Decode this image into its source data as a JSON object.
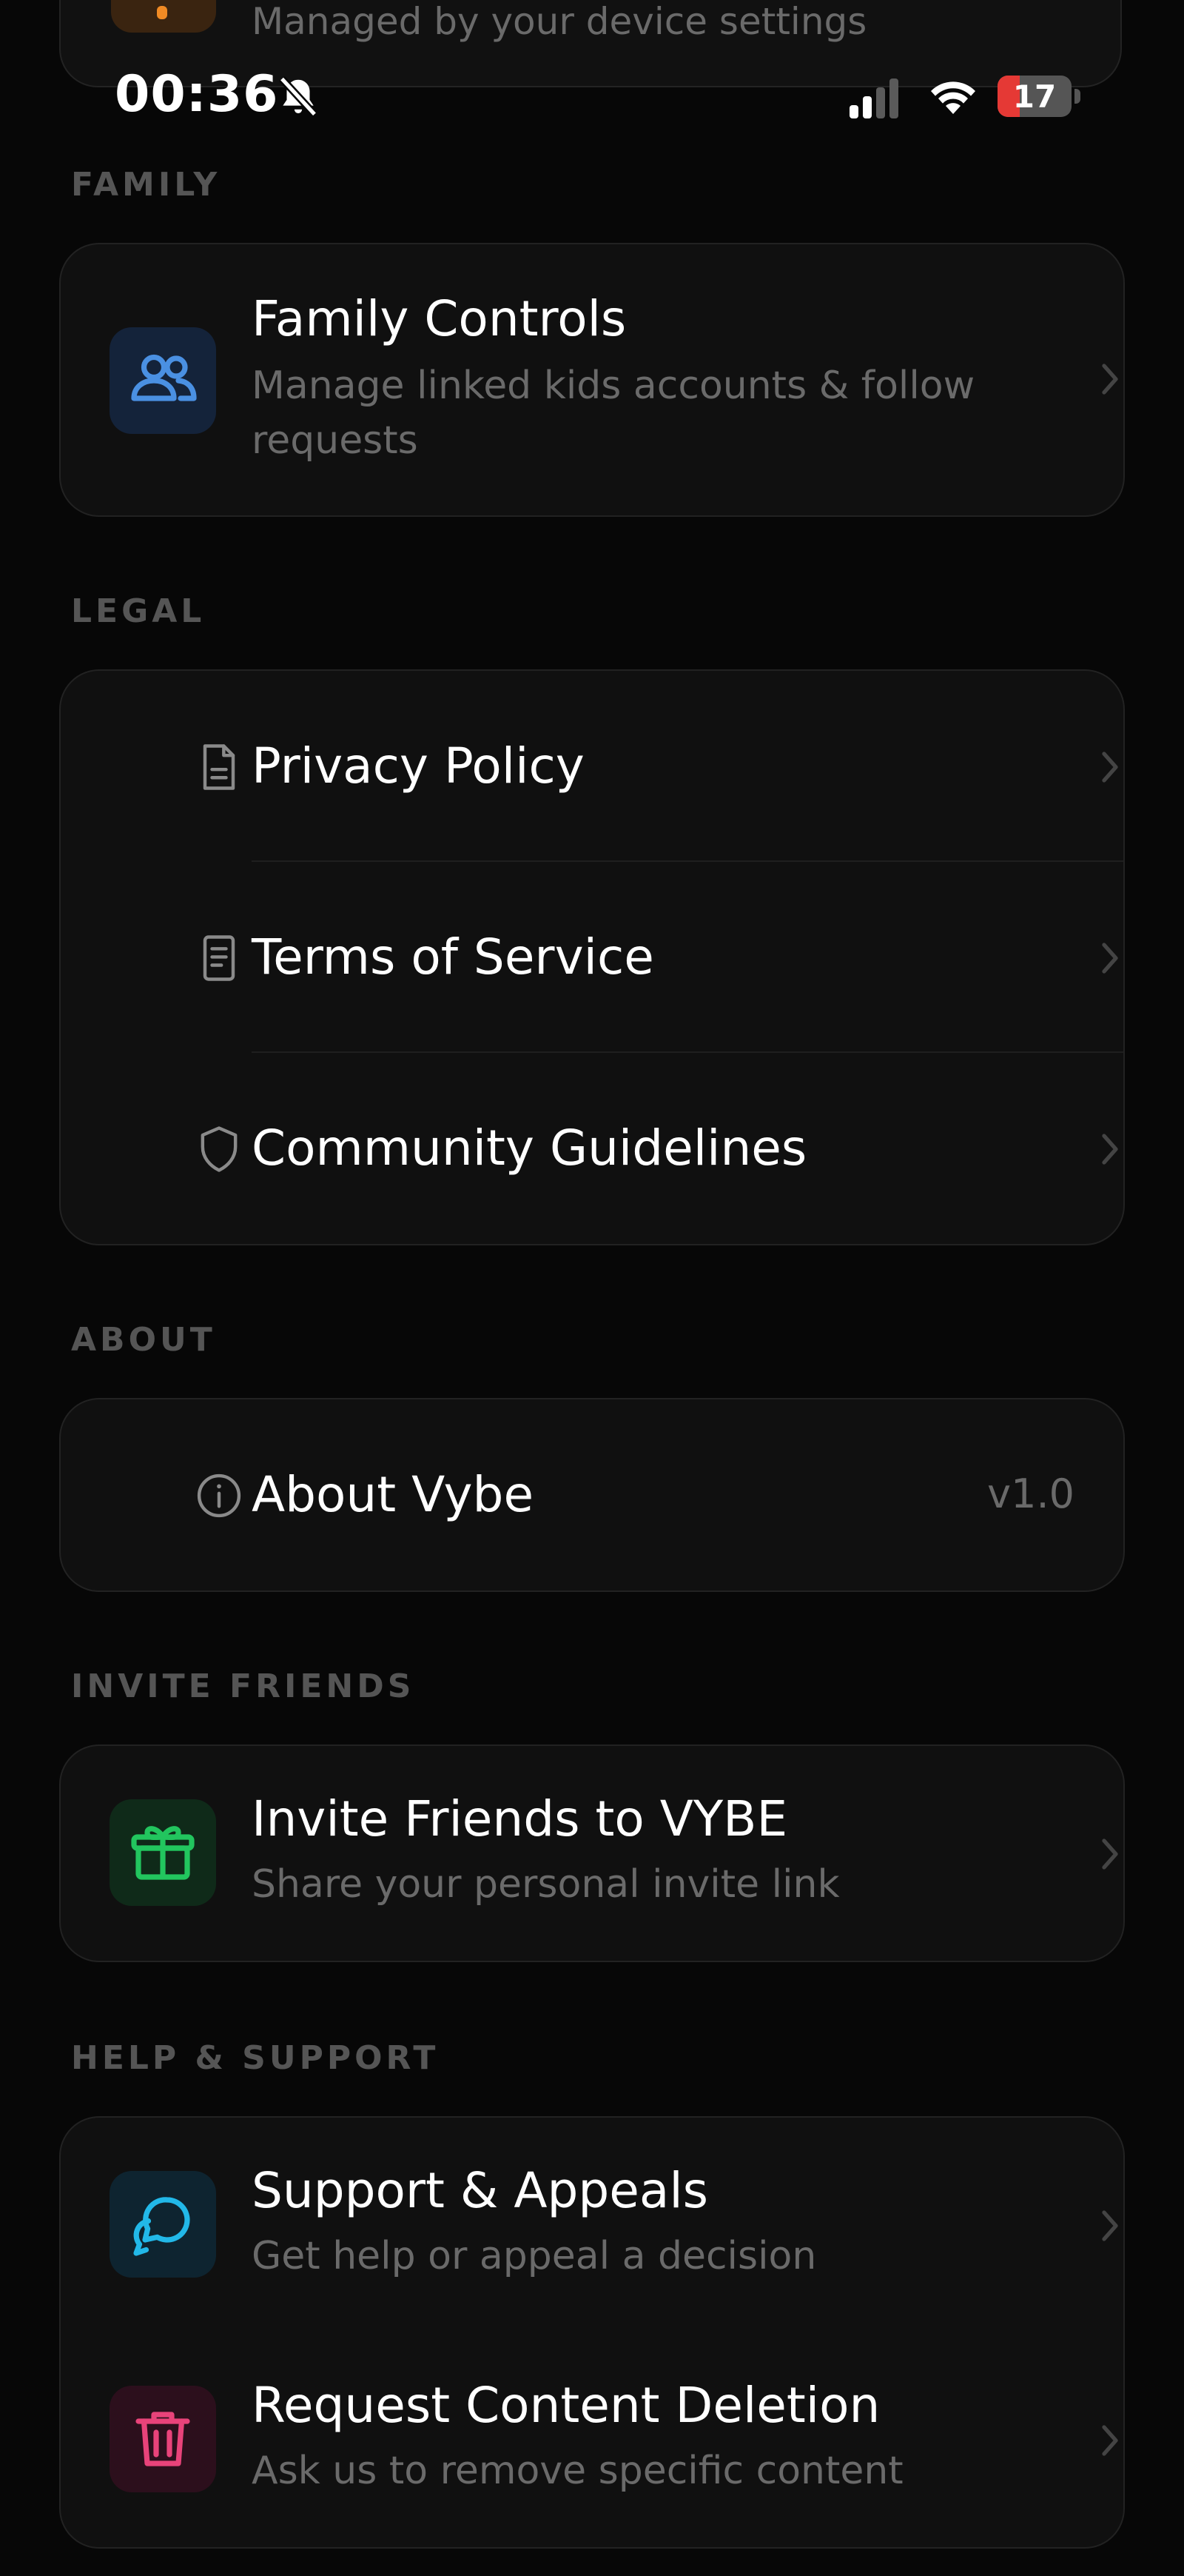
{
  "peek": {
    "subtitle": "Managed by your device settings"
  },
  "status_bar": {
    "time": "00:36",
    "battery_level": "17",
    "battery_fraction": 0.17
  },
  "colors": {
    "family_accent": "#4a90e2",
    "invite_accent": "#22c55e",
    "support_accent": "#22b8e8",
    "deletion_accent": "#e8437a"
  },
  "sections": {
    "family": {
      "title": "FAMILY",
      "items": [
        {
          "title": "Family Controls",
          "subtitle": "Manage linked kids accounts & follow requests",
          "icon": "people-icon"
        }
      ]
    },
    "legal": {
      "title": "LEGAL",
      "items": [
        {
          "title": "Privacy Policy",
          "icon": "document-icon"
        },
        {
          "title": "Terms of Service",
          "icon": "page-icon"
        },
        {
          "title": "Community Guidelines",
          "icon": "shield-icon"
        }
      ]
    },
    "about": {
      "title": "ABOUT",
      "items": [
        {
          "title": "About Vybe",
          "value": "v1.0",
          "icon": "info-icon"
        }
      ]
    },
    "invite": {
      "title": "INVITE FRIENDS",
      "items": [
        {
          "title": "Invite Friends to VYBE",
          "subtitle": "Share your personal invite link",
          "icon": "gift-icon"
        }
      ]
    },
    "help": {
      "title": "HELP & SUPPORT",
      "items": [
        {
          "title": "Support & Appeals",
          "subtitle": "Get help or appeal a decision",
          "icon": "chat-bubbles-icon"
        },
        {
          "title": "Request Content Deletion",
          "subtitle": "Ask us to remove specific content",
          "icon": "trash-icon"
        }
      ]
    }
  }
}
